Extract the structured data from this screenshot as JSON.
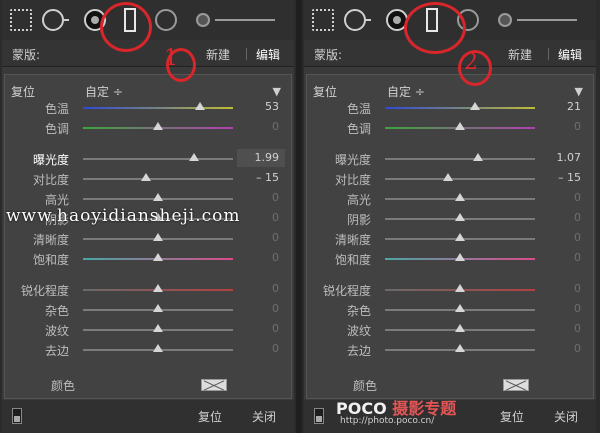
{
  "left": {
    "mask_label": "蒙版:",
    "new_label": "新建",
    "edit_label": "编辑",
    "reset_label": "复位",
    "preset_label": "自定 ÷",
    "sliders": [
      {
        "label": "色温",
        "value": "53",
        "pos": 0.78,
        "track": "temp"
      },
      {
        "label": "色调",
        "value": "0",
        "pos": 0.5,
        "track": "tint"
      },
      {
        "label": "曝光度",
        "value": "1.99",
        "pos": 0.74,
        "track": "plain",
        "active": true
      },
      {
        "label": "对比度",
        "value": "– 15",
        "pos": 0.42,
        "track": "plain"
      },
      {
        "label": "高光",
        "value": "0",
        "pos": 0.5,
        "track": "plain"
      },
      {
        "label": "阴影",
        "value": "0",
        "pos": 0.5,
        "track": "plain"
      },
      {
        "label": "清晰度",
        "value": "0",
        "pos": 0.5,
        "track": "plain"
      },
      {
        "label": "饱和度",
        "value": "0",
        "pos": 0.5,
        "track": "sat"
      },
      {
        "label": "锐化程度",
        "value": "0",
        "pos": 0.5,
        "track": "sharp"
      },
      {
        "label": "杂色",
        "value": "0",
        "pos": 0.5,
        "track": "plain"
      },
      {
        "label": "波纹",
        "value": "0",
        "pos": 0.5,
        "track": "plain"
      },
      {
        "label": "去边",
        "value": "0",
        "pos": 0.5,
        "track": "plain"
      }
    ],
    "color_label": "颜色",
    "bottom_reset": "复位",
    "bottom_close": "关闭",
    "annotation": "1"
  },
  "right": {
    "mask_label": "蒙版:",
    "new_label": "新建",
    "edit_label": "编辑",
    "reset_label": "复位",
    "preset_label": "自定 ÷",
    "sliders": [
      {
        "label": "色温",
        "value": "21",
        "pos": 0.6,
        "track": "temp"
      },
      {
        "label": "色调",
        "value": "0",
        "pos": 0.5,
        "track": "tint"
      },
      {
        "label": "曝光度",
        "value": "1.07",
        "pos": 0.62,
        "track": "plain"
      },
      {
        "label": "对比度",
        "value": "– 15",
        "pos": 0.42,
        "track": "plain"
      },
      {
        "label": "高光",
        "value": "0",
        "pos": 0.5,
        "track": "plain"
      },
      {
        "label": "阴影",
        "value": "0",
        "pos": 0.5,
        "track": "plain"
      },
      {
        "label": "清晰度",
        "value": "0",
        "pos": 0.5,
        "track": "plain"
      },
      {
        "label": "饱和度",
        "value": "0",
        "pos": 0.5,
        "track": "sat"
      },
      {
        "label": "锐化程度",
        "value": "0",
        "pos": 0.5,
        "track": "sharp"
      },
      {
        "label": "杂色",
        "value": "0",
        "pos": 0.5,
        "track": "plain"
      },
      {
        "label": "波纹",
        "value": "0",
        "pos": 0.5,
        "track": "plain"
      },
      {
        "label": "去边",
        "value": "0",
        "pos": 0.5,
        "track": "plain"
      }
    ],
    "color_label": "颜色",
    "bottom_reset": "复位",
    "bottom_close": "关闭",
    "annotation": "2"
  },
  "watermark": {
    "site": "www.haoyidiansheji.com",
    "poco_brand": "POCO",
    "poco_cn": "摄影专题",
    "poco_url": "http://photo.poco.cn/"
  },
  "colors": {
    "annotation": "#d8262b",
    "panel": "#3a3a3a",
    "settings": "#424242"
  }
}
